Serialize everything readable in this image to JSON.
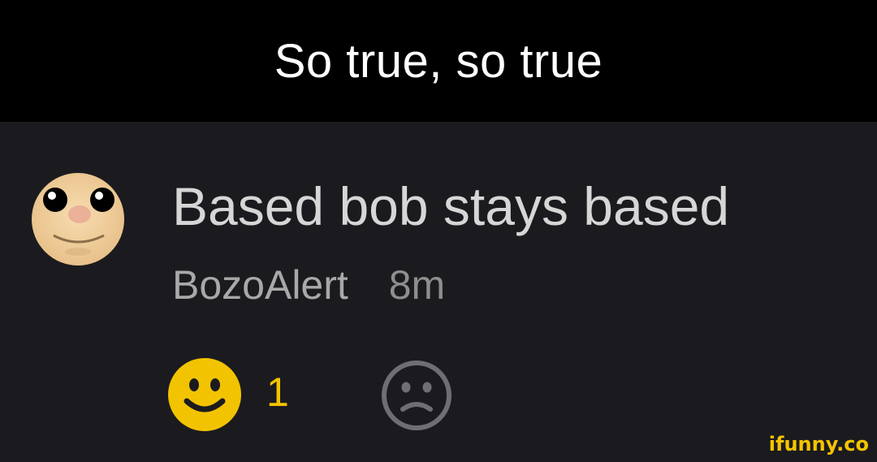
{
  "caption": {
    "text": "So true, so true"
  },
  "comment": {
    "text": "Based bob stays based",
    "username": "BozoAlert",
    "timestamp": "8m",
    "avatar_icon": "yellow-face-avatar"
  },
  "reactions": {
    "like_count": "1",
    "like_icon": "smiley-face-icon",
    "dislike_icon": "frowny-face-icon"
  },
  "watermark": {
    "text": "ifunny.co"
  },
  "colors": {
    "caption_bg": "#000000",
    "comment_bg": "#1b1b1f",
    "accent_yellow": "#f2c300",
    "text_primary": "#d6d6d6",
    "text_secondary": "#a8a8a8"
  }
}
